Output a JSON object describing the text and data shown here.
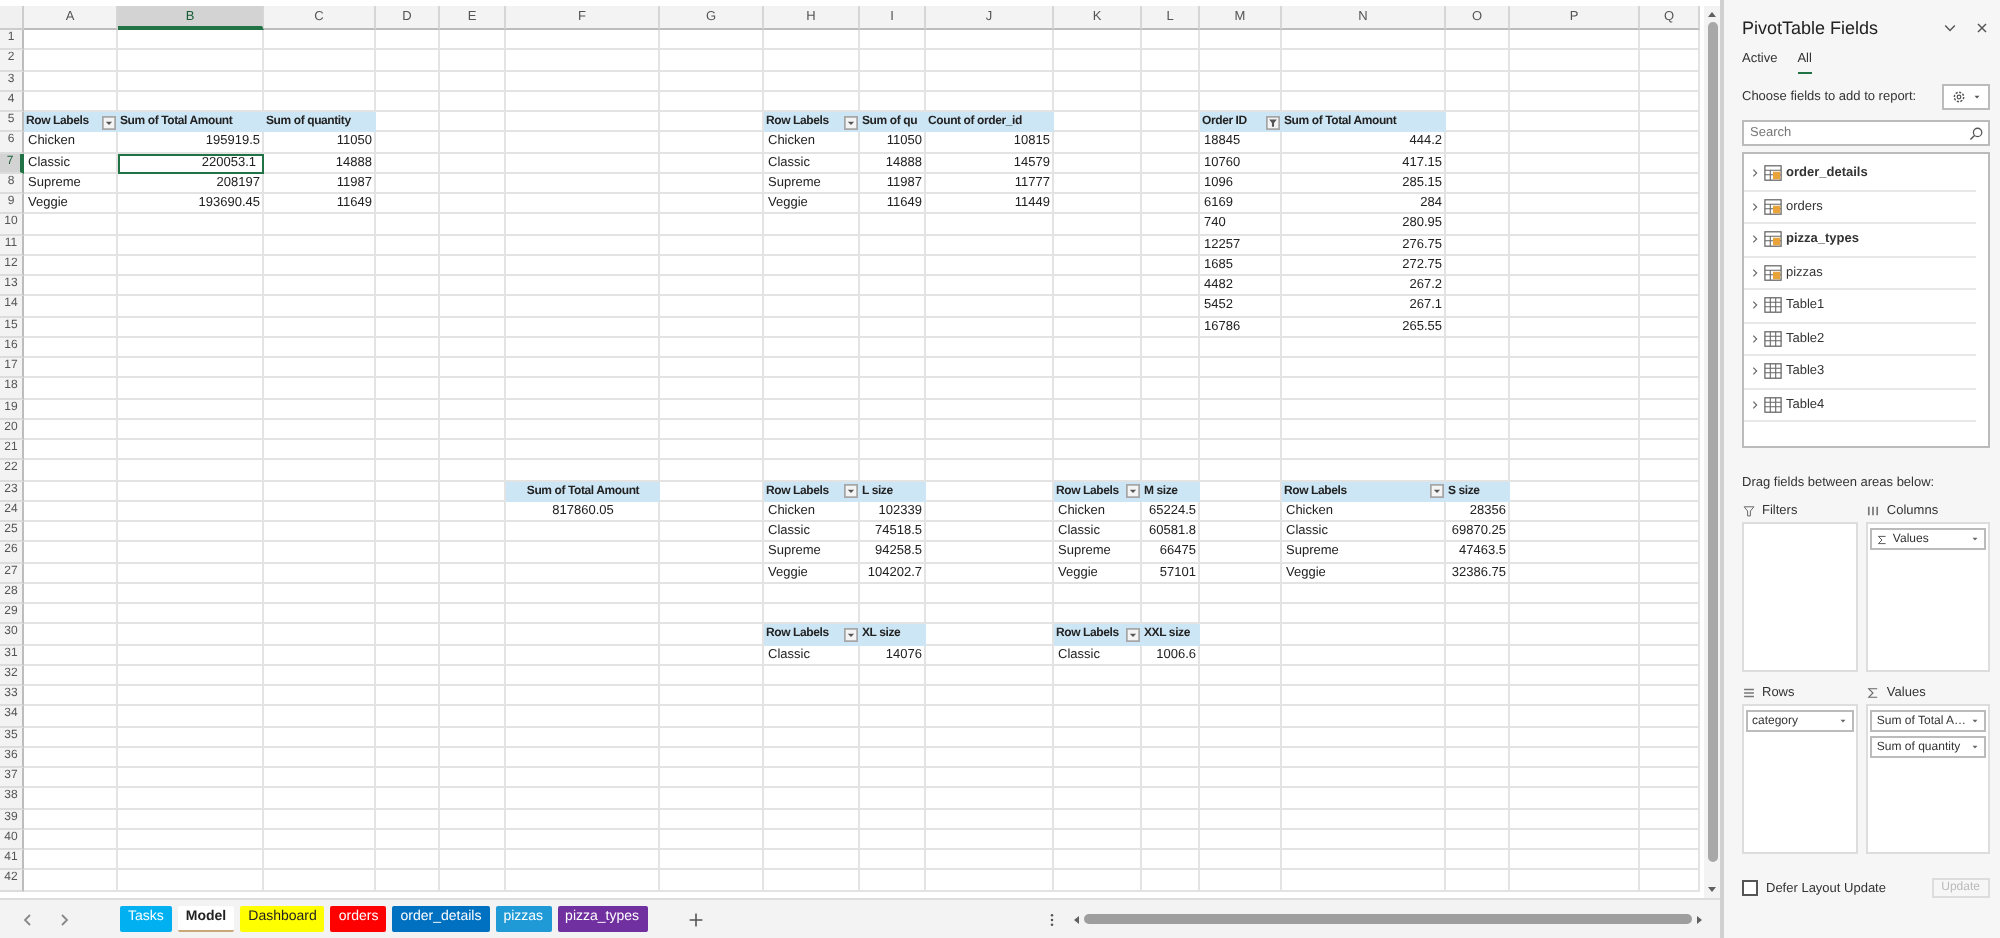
{
  "sheet": {
    "columns": [
      {
        "label": "A",
        "selected": false
      },
      {
        "label": "B",
        "selected": true
      },
      {
        "label": "C",
        "selected": false
      },
      {
        "label": "D",
        "selected": false
      },
      {
        "label": "E",
        "selected": false
      },
      {
        "label": "F",
        "selected": false
      },
      {
        "label": "G",
        "selected": false
      },
      {
        "label": "H",
        "selected": false
      },
      {
        "label": "I",
        "selected": false
      },
      {
        "label": "J",
        "selected": false
      },
      {
        "label": "K",
        "selected": false
      },
      {
        "label": "L",
        "selected": false
      },
      {
        "label": "M",
        "selected": false
      },
      {
        "label": "N",
        "selected": false
      },
      {
        "label": "O",
        "selected": false
      },
      {
        "label": "P",
        "selected": false
      },
      {
        "label": "Q",
        "selected": false
      }
    ],
    "rows": [
      {
        "label": "1",
        "selected": false
      },
      {
        "label": "2",
        "selected": false
      },
      {
        "label": "3",
        "selected": false
      },
      {
        "label": "4",
        "selected": false
      },
      {
        "label": "5",
        "selected": false
      },
      {
        "label": "6",
        "selected": false
      },
      {
        "label": "7",
        "selected": true
      },
      {
        "label": "8",
        "selected": false
      },
      {
        "label": "9",
        "selected": false
      },
      {
        "label": "10",
        "selected": false
      },
      {
        "label": "11",
        "selected": false
      },
      {
        "label": "12",
        "selected": false
      },
      {
        "label": "13",
        "selected": false
      },
      {
        "label": "14",
        "selected": false
      },
      {
        "label": "15",
        "selected": false
      },
      {
        "label": "16",
        "selected": false
      },
      {
        "label": "17",
        "selected": false
      },
      {
        "label": "18",
        "selected": false
      },
      {
        "label": "19",
        "selected": false
      },
      {
        "label": "20",
        "selected": false
      },
      {
        "label": "21",
        "selected": false
      },
      {
        "label": "22",
        "selected": false
      },
      {
        "label": "23",
        "selected": false
      },
      {
        "label": "24",
        "selected": false
      },
      {
        "label": "25",
        "selected": false
      },
      {
        "label": "26",
        "selected": false
      },
      {
        "label": "27",
        "selected": false
      },
      {
        "label": "28",
        "selected": false
      },
      {
        "label": "29",
        "selected": false
      },
      {
        "label": "30",
        "selected": false
      },
      {
        "label": "31",
        "selected": false
      },
      {
        "label": "32",
        "selected": false
      },
      {
        "label": "33",
        "selected": false
      },
      {
        "label": "34",
        "selected": false
      },
      {
        "label": "35",
        "selected": false
      },
      {
        "label": "36",
        "selected": false
      },
      {
        "label": "37",
        "selected": false
      },
      {
        "label": "38",
        "selected": false
      },
      {
        "label": "39",
        "selected": false
      },
      {
        "label": "40",
        "selected": false
      },
      {
        "label": "41",
        "selected": false
      },
      {
        "label": "42",
        "selected": false
      }
    ],
    "pivots": [
      {
        "kind": "table",
        "headers": [
          {
            "text": "Row Labels",
            "kind": "dropdown"
          },
          {
            "text": "Sum of Total Amount",
            "kind": "plain"
          },
          {
            "text": "Sum of quantity",
            "kind": "plain"
          }
        ],
        "rows": [
          [
            "Chicken",
            "195919.5",
            "11050"
          ],
          [
            "Classic",
            "220053.1",
            "14888"
          ],
          [
            "Supreme",
            "208197",
            "11987"
          ],
          [
            "Veggie",
            "193690.45",
            "11649"
          ]
        ]
      },
      {
        "kind": "table",
        "headers": [
          {
            "text": "Row Labels",
            "kind": "dropdown"
          },
          {
            "text": "Sum of qu",
            "kind": "plain"
          },
          {
            "text": "Count of order_id",
            "kind": "plain"
          }
        ],
        "rows": [
          [
            "Chicken",
            "11050",
            "10815"
          ],
          [
            "Classic",
            "14888",
            "14579"
          ],
          [
            "Supreme",
            "11987",
            "11777"
          ],
          [
            "Veggie",
            "11649",
            "11449"
          ]
        ]
      },
      {
        "kind": "table",
        "headers": [
          {
            "text": "Order ID",
            "kind": "filter"
          },
          {
            "text": "Sum of Total Amount",
            "kind": "plain"
          }
        ],
        "rows": [
          [
            "18845",
            "444.2"
          ],
          [
            "10760",
            "417.15"
          ],
          [
            "1096",
            "285.15"
          ],
          [
            "6169",
            "284"
          ],
          [
            "740",
            "280.95"
          ],
          [
            "12257",
            "276.75"
          ],
          [
            "1685",
            "272.75"
          ],
          [
            "4482",
            "267.2"
          ],
          [
            "5452",
            "267.1"
          ],
          [
            "16786",
            "265.55"
          ]
        ]
      },
      {
        "kind": "single",
        "headers": [
          {
            "text": "Sum of Total Amount",
            "kind": "plain"
          }
        ],
        "rows": [
          [
            "817860.05"
          ]
        ]
      },
      {
        "kind": "table",
        "headers": [
          {
            "text": "Row Labels",
            "kind": "dropdown"
          },
          {
            "text": "L size",
            "kind": "plain"
          }
        ],
        "rows": [
          [
            "Chicken",
            "102339"
          ],
          [
            "Classic",
            "74518.5"
          ],
          [
            "Supreme",
            "94258.5"
          ],
          [
            "Veggie",
            "104202.7"
          ]
        ]
      },
      {
        "kind": "table",
        "headers": [
          {
            "text": "Row Labels",
            "kind": "dropdown"
          },
          {
            "text": "M size",
            "kind": "plain"
          }
        ],
        "rows": [
          [
            "Chicken",
            "65224.5"
          ],
          [
            "Classic",
            "60581.8"
          ],
          [
            "Supreme",
            "66475"
          ],
          [
            "Veggie",
            "57101"
          ]
        ]
      },
      {
        "kind": "table",
        "headers": [
          {
            "text": "Row Labels",
            "kind": "dropdown"
          },
          {
            "text": "S size",
            "kind": "plain"
          }
        ],
        "rows": [
          [
            "Chicken",
            "28356"
          ],
          [
            "Classic",
            "69870.25"
          ],
          [
            "Supreme",
            "47463.5"
          ],
          [
            "Veggie",
            "32386.75"
          ]
        ]
      },
      {
        "kind": "table",
        "headers": [
          {
            "text": "Row Labels",
            "kind": "dropdown"
          },
          {
            "text": "XL size",
            "kind": "plain"
          }
        ],
        "rows": [
          [
            "Classic",
            "14076"
          ]
        ]
      },
      {
        "kind": "table",
        "headers": [
          {
            "text": "Row Labels",
            "kind": "dropdown"
          },
          {
            "text": "XXL size",
            "kind": "plain"
          }
        ],
        "rows": [
          [
            "Classic",
            "1006.6"
          ]
        ]
      }
    ]
  },
  "sheet_tabs": [
    {
      "label": "Tasks",
      "color": "#00b0f0",
      "selected": false
    },
    {
      "label": "Model",
      "color": "#c9a97a",
      "selected": true
    },
    {
      "label": "Dashboard",
      "color": "#ffff00",
      "selected": false
    },
    {
      "label": "orders",
      "color": "#ff0000",
      "selected": false
    },
    {
      "label": "order_details",
      "color": "#0070c0",
      "selected": false
    },
    {
      "label": "pizzas",
      "color": "#1f9ad6",
      "selected": false
    },
    {
      "label": "pizza_types",
      "color": "#7030a0",
      "selected": false
    }
  ],
  "pivot_pane": {
    "title": "PivotTable Fields",
    "tabs": [
      {
        "label": "Active",
        "selected": false
      },
      {
        "label": "All",
        "selected": true
      }
    ],
    "choose_label": "Choose fields to add to report:",
    "search": {
      "placeholder": "Search"
    },
    "fields": [
      {
        "name": "order_details",
        "kind": "model",
        "in_use": true
      },
      {
        "name": "orders",
        "kind": "model",
        "in_use": false
      },
      {
        "name": "pizza_types",
        "kind": "model",
        "in_use": true
      },
      {
        "name": "pizzas",
        "kind": "model",
        "in_use": false
      },
      {
        "name": "Table1",
        "kind": "table",
        "in_use": false
      },
      {
        "name": "Table2",
        "kind": "table",
        "in_use": false
      },
      {
        "name": "Table3",
        "kind": "table",
        "in_use": false
      },
      {
        "name": "Table4",
        "kind": "table",
        "in_use": false
      }
    ],
    "drag_label": "Drag fields between areas below:",
    "areas": [
      {
        "kind": "filters",
        "label": "Filters"
      },
      {
        "kind": "columns",
        "label": "Columns",
        "items": [
          {
            "text": "Values",
            "kind": "values"
          }
        ]
      },
      {
        "kind": "rows",
        "label": "Rows",
        "items": [
          {
            "text": "category",
            "kind": "field"
          }
        ]
      },
      {
        "kind": "values",
        "label": "Values",
        "items": [
          {
            "text": "Sum of Total A…",
            "kind": "field"
          },
          {
            "text": "Sum of quantity",
            "kind": "field"
          }
        ]
      }
    ],
    "defer": {
      "label": "Defer Layout Update",
      "checked": false
    },
    "update_button": {
      "label": "Update",
      "disabled": true
    }
  }
}
